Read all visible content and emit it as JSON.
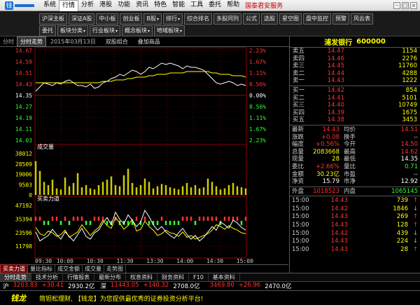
{
  "menubar": {
    "items": [
      "系统",
      "行情",
      "分析",
      "港股",
      "功能",
      "资讯",
      "特色",
      "智能",
      "工具",
      "委托",
      "帮助"
    ],
    "active_index": 1,
    "broker": "国泰君安服务",
    "window_buttons": [
      "-",
      "□",
      "×"
    ]
  },
  "toolbar": {
    "row1": [
      "沪深主板",
      "深证A股",
      "中小板",
      "创业板",
      "B股",
      "排行",
      "综合排名",
      "多股同列",
      "公式",
      "选股",
      "星空图",
      "盘中监控",
      "预警",
      "风云表"
    ],
    "row1_dropdown": [
      false,
      false,
      false,
      false,
      true,
      true,
      false,
      false,
      false,
      false,
      false,
      false,
      false,
      false
    ],
    "row2": [
      "委托",
      "板块分类",
      "行业板块",
      "概念板块",
      "地域板块"
    ],
    "row2_dropdown": [
      false,
      true,
      true,
      true,
      true
    ]
  },
  "chart_tabs": {
    "tabs": [
      "分时",
      "分时走势"
    ],
    "active_index": 1,
    "date": "2015年03月13日",
    "mode": "双股组合",
    "overlay": "叠加商品",
    "nav_icons": [
      "◀",
      "▶"
    ]
  },
  "chart_data": {
    "type": "line",
    "price_axis": [
      "14.67",
      "14.59",
      "14.51",
      "14.43",
      "14.35",
      "14.27",
      "14.19",
      "14.11",
      "14.03"
    ],
    "pct_axis": [
      "2.23%",
      "1.67%",
      "1.11%",
      "0.56%",
      "0.00%",
      "0.56%",
      "1.11%",
      "1.67%",
      "2.23%"
    ],
    "pct_colors": [
      "#ff3333",
      "#ff3333",
      "#ff3333",
      "#ff3333",
      "#ffffff",
      "#33ff33",
      "#33ff33",
      "#33ff33",
      "#33ff33"
    ],
    "prev_close": 14.35,
    "ylim": [
      14.03,
      14.67
    ],
    "price": [
      14.38,
      14.41,
      14.44,
      14.43,
      14.42,
      14.44,
      14.43,
      14.45,
      14.46,
      14.44,
      14.42,
      14.42,
      14.41,
      14.43,
      14.4,
      14.41,
      14.44,
      14.45,
      14.47,
      14.48,
      14.5,
      14.49,
      14.51,
      14.53,
      14.52,
      14.5,
      14.52,
      14.55,
      14.54,
      14.56,
      14.58,
      14.57,
      14.58,
      14.57,
      14.56,
      14.54,
      14.56,
      14.55,
      14.55,
      14.54,
      14.53,
      14.5,
      14.47,
      14.44,
      14.43,
      14.44,
      14.45,
      14.44,
      14.42,
      14.43,
      14.42
    ],
    "avg": [
      14.44,
      14.44,
      14.44,
      14.44,
      14.44,
      14.44,
      14.44,
      14.44,
      14.44,
      14.44,
      14.44,
      14.44,
      14.44,
      14.44,
      14.44,
      14.44,
      14.45,
      14.45,
      14.45,
      14.46,
      14.46,
      14.46,
      14.47,
      14.47,
      14.48,
      14.48,
      14.48,
      14.49,
      14.49,
      14.5,
      14.5,
      14.5,
      14.51,
      14.51,
      14.51,
      14.51,
      14.52,
      14.52,
      14.52,
      14.52,
      14.52,
      14.52,
      14.51,
      14.51,
      14.5,
      14.5,
      14.5,
      14.49,
      14.49,
      14.49,
      14.48
    ],
    "volume_label": "成交量",
    "volume_axis": [
      "38012",
      "28509",
      "19006",
      "9503",
      "0"
    ],
    "volume_ylim": [
      0,
      47500
    ],
    "volume": [
      31000,
      22000,
      12000,
      9000,
      14000,
      6000,
      5000,
      16000,
      8000,
      11000,
      20000,
      7000,
      9000,
      6000,
      5000,
      9000,
      12000,
      14000,
      17000,
      9000,
      8000,
      18000,
      24000,
      11000,
      7000,
      9000,
      15000,
      12000,
      6000,
      8000,
      10000,
      9000,
      7000,
      6000,
      5000,
      8000,
      11000,
      7000,
      9000,
      6000,
      7000,
      15000,
      12000,
      8000,
      5000,
      6000,
      9000,
      11000,
      8000,
      7000,
      6000
    ],
    "force_label": "买卖力道",
    "force_axis": [
      "47192",
      "35394",
      "23596",
      "11798"
    ],
    "force_ylim": [
      0,
      53000
    ],
    "force_white": [
      22000,
      12000,
      15000,
      18000,
      25000,
      19000,
      14000,
      22000,
      17000,
      12000,
      19000,
      26000,
      17000,
      14000,
      21000,
      24000,
      32000,
      38000,
      30000,
      44000,
      36000,
      31000,
      41000,
      35000,
      28000,
      33000,
      46000,
      39000,
      30000,
      24000,
      28000,
      22000,
      18000,
      15000,
      21000,
      26000,
      19000,
      14000,
      18000,
      12000,
      16000,
      22000,
      28000,
      24000,
      33000,
      30000,
      26000,
      35000,
      32000,
      27000,
      24000
    ],
    "force_yellow": [
      27000,
      20000,
      18000,
      23000,
      21000,
      17000,
      19000,
      24000,
      16000,
      19000,
      22000,
      30000,
      24000,
      18000,
      23000,
      27000,
      35000,
      29000,
      26000,
      38000,
      32000,
      25000,
      29000,
      36000,
      23000,
      25000,
      34000,
      28000,
      24000,
      18000,
      20000,
      24000,
      21000,
      20000,
      17000,
      22000,
      16000,
      18000,
      14000,
      16000,
      18000,
      20000,
      24000,
      30000,
      28000,
      25000,
      29000,
      26000,
      24000,
      21000,
      20000
    ],
    "force_bars": [
      1,
      1,
      -1,
      -1,
      1,
      1,
      -1,
      1,
      -1,
      1,
      1,
      1,
      -1,
      -1,
      1,
      1,
      1,
      -1,
      -1,
      1,
      -1,
      -1,
      -1,
      -1,
      1,
      -1,
      1,
      -1,
      -1,
      -1,
      1,
      -1,
      -1,
      -1,
      -1,
      1,
      1,
      1,
      -1,
      1,
      1,
      1,
      1,
      1,
      -1,
      1,
      1,
      1,
      1,
      -1,
      1
    ],
    "time_labels": [
      "09:30",
      "10:00",
      "10:30",
      "11:30",
      "13:30",
      "14:00",
      "14:30",
      "15:00"
    ]
  },
  "subtabs": {
    "items": [
      "买卖力道",
      "量比指标",
      "成交金额",
      "成交量",
      "走势图"
    ],
    "active_index": 0
  },
  "quote": {
    "name": "浦发银行",
    "code": "600000",
    "asks": [
      {
        "label": "卖五",
        "price": "14.47",
        "vol": "1154"
      },
      {
        "label": "卖四",
        "price": "14.46",
        "vol": "2276"
      },
      {
        "label": "卖三",
        "price": "14.45",
        "vol": "11760"
      },
      {
        "label": "卖二",
        "price": "14.44",
        "vol": "4288"
      },
      {
        "label": "卖一",
        "price": "14.43",
        "vol": "1222"
      }
    ],
    "bids": [
      {
        "label": "买一",
        "price": "14.42",
        "vol": "854"
      },
      {
        "label": "买二",
        "price": "14.41",
        "vol": "5101"
      },
      {
        "label": "买三",
        "price": "14.40",
        "vol": "10749"
      },
      {
        "label": "买四",
        "price": "14.39",
        "vol": "1675"
      },
      {
        "label": "买五",
        "price": "14.38",
        "vol": "3453"
      }
    ],
    "stats": [
      {
        "l1": "最新",
        "v1": "14.43",
        "c1": "#ff3333",
        "l2": "均价",
        "v2": "14.51",
        "c2": "#ff3333"
      },
      {
        "l1": "涨跌",
        "v1": "+0.08",
        "c1": "#ff3333",
        "l2": "换手",
        "v2": "--",
        "c2": "#cccccc"
      },
      {
        "l1": "幅度",
        "v1": "+0.56%",
        "c1": "#ff3333",
        "l2": "今开",
        "v2": "14.50",
        "c2": "#ff3333"
      },
      {
        "l1": "总量",
        "v1": "2083668",
        "c1": "#ffff00",
        "l2": "最高",
        "v2": "14.62",
        "c2": "#ff3333"
      },
      {
        "l1": "现量",
        "v1": "28",
        "c1": "#ffff00",
        "l2": "最低",
        "v2": "14.35",
        "c2": "#ffffff"
      },
      {
        "l1": "委比",
        "v1": "+2.66%",
        "c1": "#ff3333",
        "l2": "量比",
        "v2": "0.71",
        "c2": "#33ff33"
      },
      {
        "l1": "金额",
        "v1": "30.23亿",
        "c1": "#ffff00",
        "l2": "市盈",
        "v2": "--",
        "c2": "#cccccc"
      },
      {
        "l1": "净资",
        "v1": "15.79",
        "c1": "#ffffff",
        "l2": "市净",
        "v2": "12.92",
        "c2": "#ffffff"
      }
    ],
    "outer": {
      "label": "外盘",
      "value": "1018523",
      "label2": "内盘",
      "value2": "1065145"
    },
    "trades": [
      {
        "time": "15:00",
        "price": "14.43",
        "vol": "739",
        "dir": "↑",
        "dc": "#ff3333"
      },
      {
        "time": "15:00",
        "price": "14.42",
        "vol": "1846",
        "dir": "↓",
        "dc": "#33ff33"
      },
      {
        "time": "15:00",
        "price": "14.43",
        "vol": "269",
        "dir": "↑",
        "dc": "#ff3333"
      },
      {
        "time": "15:00",
        "price": "14.43",
        "vol": "128",
        "dir": "↑",
        "dc": "#ff3333"
      },
      {
        "time": "15:00",
        "price": "14.42",
        "vol": "439",
        "dir": "↓",
        "dc": "#33ff33"
      },
      {
        "time": "15:00",
        "price": "14.43",
        "vol": "224",
        "dir": "↓",
        "dc": "#33ff33"
      },
      {
        "time": "15:00",
        "price": "14.43",
        "vol": "28",
        "dir": "↑",
        "dc": "#ff3333"
      }
    ]
  },
  "bottomtabs": {
    "items": [
      "分时走势",
      "技术分析",
      "行情报表",
      "最新分布",
      "权息资料",
      "财务资料",
      "F10",
      "基本资料"
    ],
    "active_index": 0
  },
  "indexbar": [
    {
      "name": "沪",
      "point": "3203.83",
      "change": "+30.41",
      "amount": "2930.2亿"
    },
    {
      "name": "深",
      "point": "11443.05",
      "change": "+140.32",
      "amount": "2708.0亿"
    },
    {
      "name": "",
      "point": "3469.80",
      "change": "+26.96",
      "amount": "2470.0亿"
    }
  ],
  "ticker": {
    "logo": "钱龙",
    "message": "简钽松理财, 【钱龙】为您提供最优秀的证券投资分析平台!"
  }
}
